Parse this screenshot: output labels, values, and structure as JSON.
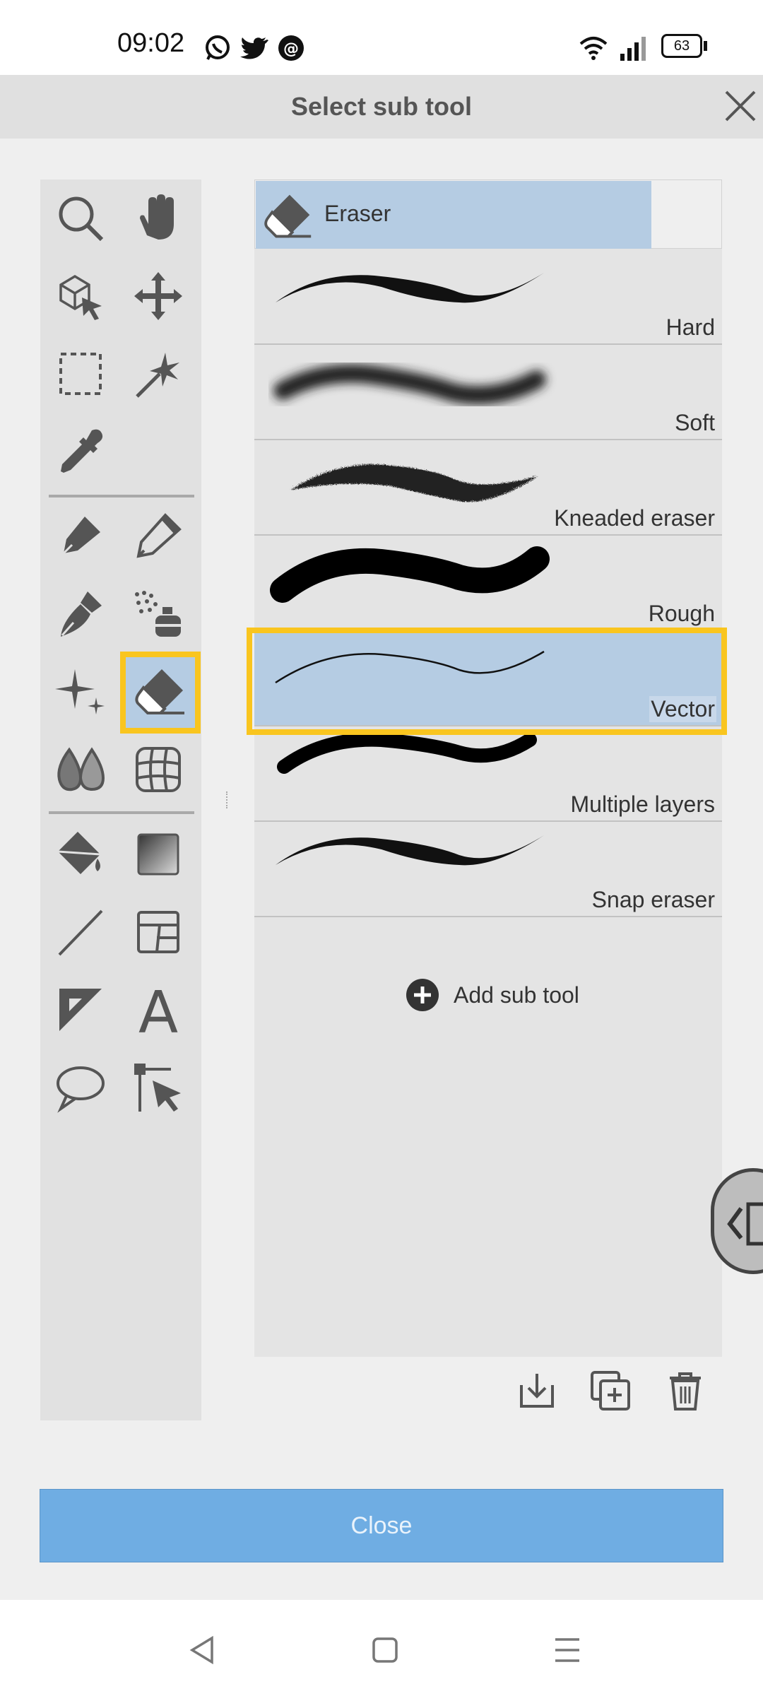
{
  "status_bar": {
    "time": "09:02",
    "notification_icons": [
      "whatsapp-icon",
      "twitter-icon",
      "threads-icon"
    ],
    "battery": "63"
  },
  "dialog": {
    "title": "Select sub tool"
  },
  "tools": [
    "zoom-icon",
    "hand-icon",
    "object-icon",
    "move-icon",
    "rect-select-icon",
    "auto-select-icon",
    "eyedropper-icon",
    "pen-icon",
    "pencil-icon",
    "brush-icon",
    "airbrush-icon",
    "decoration-icon",
    "eraser-icon",
    "blend-icon",
    "mesh-icon",
    "fill-icon",
    "gradient-icon",
    "line-icon",
    "frame-icon",
    "ruler-icon",
    "text-icon",
    "balloon-icon",
    "correct-line-icon"
  ],
  "selected_tool": "eraser-icon",
  "sub_tool_group": {
    "label": "Eraser"
  },
  "sub_tools": [
    {
      "label": "Hard",
      "selected": false
    },
    {
      "label": "Soft",
      "selected": false
    },
    {
      "label": "Kneaded eraser",
      "selected": false
    },
    {
      "label": "Rough",
      "selected": false
    },
    {
      "label": "Vector",
      "selected": true
    },
    {
      "label": "Multiple layers",
      "selected": false
    },
    {
      "label": "Snap eraser",
      "selected": false
    }
  ],
  "add_sub_tool_label": "Add sub tool",
  "close_label": "Close",
  "accent_color": "#6fade3",
  "highlight_color": "#f9c51f",
  "selection_color": "#b5cce3"
}
